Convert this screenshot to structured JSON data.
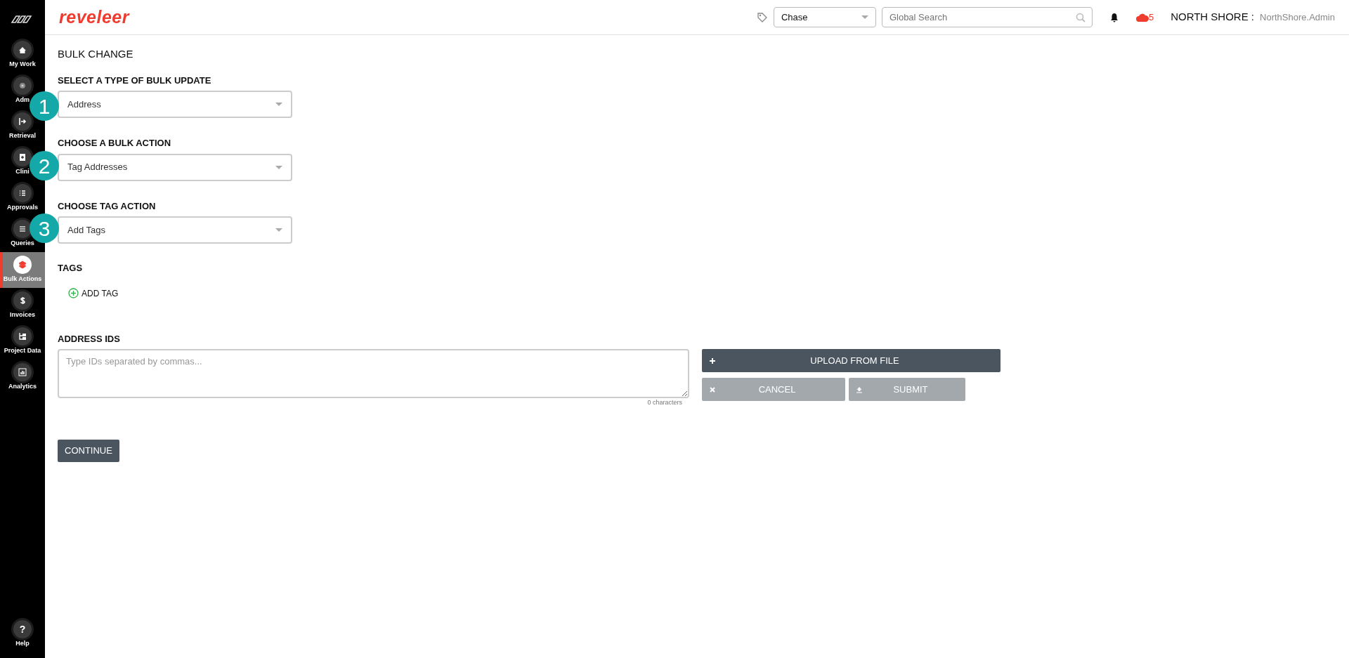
{
  "header": {
    "logo": "reveleer",
    "entity_select": {
      "value": "Chase"
    },
    "search": {
      "placeholder": "Global Search"
    },
    "alert_count": "5",
    "org": "NORTH SHORE :",
    "user": "NorthShore.Admin"
  },
  "sidebar": {
    "items": [
      {
        "label": "My Work",
        "selected": false
      },
      {
        "label": "Adm",
        "selected": false
      },
      {
        "label": "Retrieval",
        "selected": false
      },
      {
        "label": "Clini",
        "selected": false
      },
      {
        "label": "Approvals",
        "selected": false
      },
      {
        "label": "Queries",
        "selected": false
      },
      {
        "label": "Bulk Actions",
        "selected": true
      },
      {
        "label": "Invoices",
        "selected": false
      },
      {
        "label": "Project Data",
        "selected": false
      },
      {
        "label": "Analytics",
        "selected": false
      }
    ],
    "help": {
      "label": "Help",
      "icon": "?"
    }
  },
  "callouts": [
    "1",
    "2",
    "3"
  ],
  "page": {
    "title": "BULK CHANGE",
    "selects": [
      {
        "label": "SELECT A TYPE OF BULK UPDATE",
        "value": "Address"
      },
      {
        "label": "CHOOSE A BULK ACTION",
        "value": "Tag Addresses"
      },
      {
        "label": "CHOOSE TAG ACTION",
        "value": "Add Tags"
      }
    ],
    "tags": {
      "label": "TAGS",
      "add": "ADD TAG"
    },
    "ids": {
      "label": "ADDRESS IDS",
      "placeholder": "Type IDs separated by commas...",
      "count": "0 characters"
    },
    "buttons": [
      {
        "kind": "upload",
        "label": "UPLOAD FROM FILE",
        "disabled": false
      },
      {
        "kind": "cancel",
        "label": "CANCEL",
        "disabled": true
      },
      {
        "kind": "submit",
        "label": "SUBMIT",
        "disabled": true
      }
    ],
    "continue": "CONTINUE"
  }
}
